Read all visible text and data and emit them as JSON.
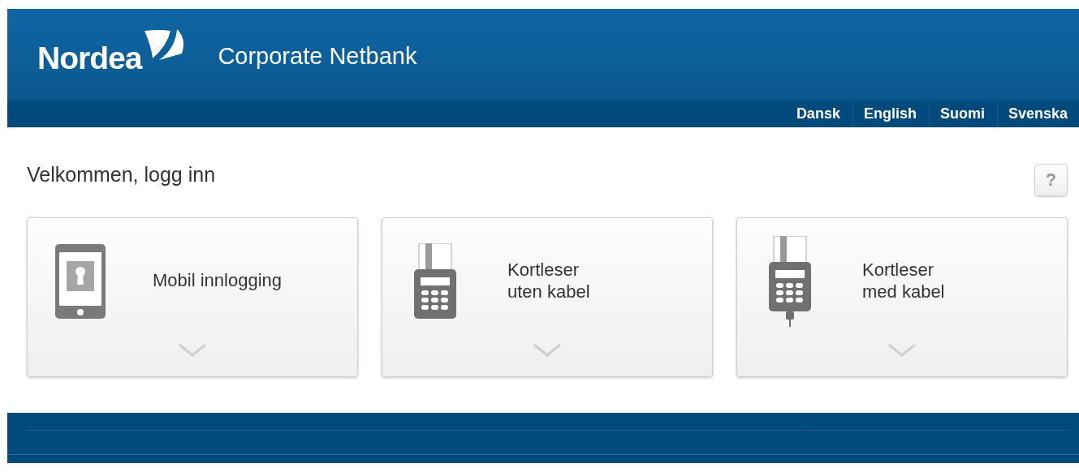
{
  "header": {
    "logo_text": "Nordea",
    "title": "Corporate Netbank"
  },
  "languages": [
    {
      "label": "Dansk"
    },
    {
      "label": "English"
    },
    {
      "label": "Suomi"
    },
    {
      "label": "Svenska"
    }
  ],
  "heading": "Velkommen, logg inn",
  "help_button": "?",
  "login_options": [
    {
      "kind": "mobile",
      "label": "Mobil innlogging"
    },
    {
      "kind": "reader",
      "label": "Kortleser\nuten kabel"
    },
    {
      "kind": "reader-cable",
      "label": "Kortleser\nmed kabel"
    }
  ]
}
